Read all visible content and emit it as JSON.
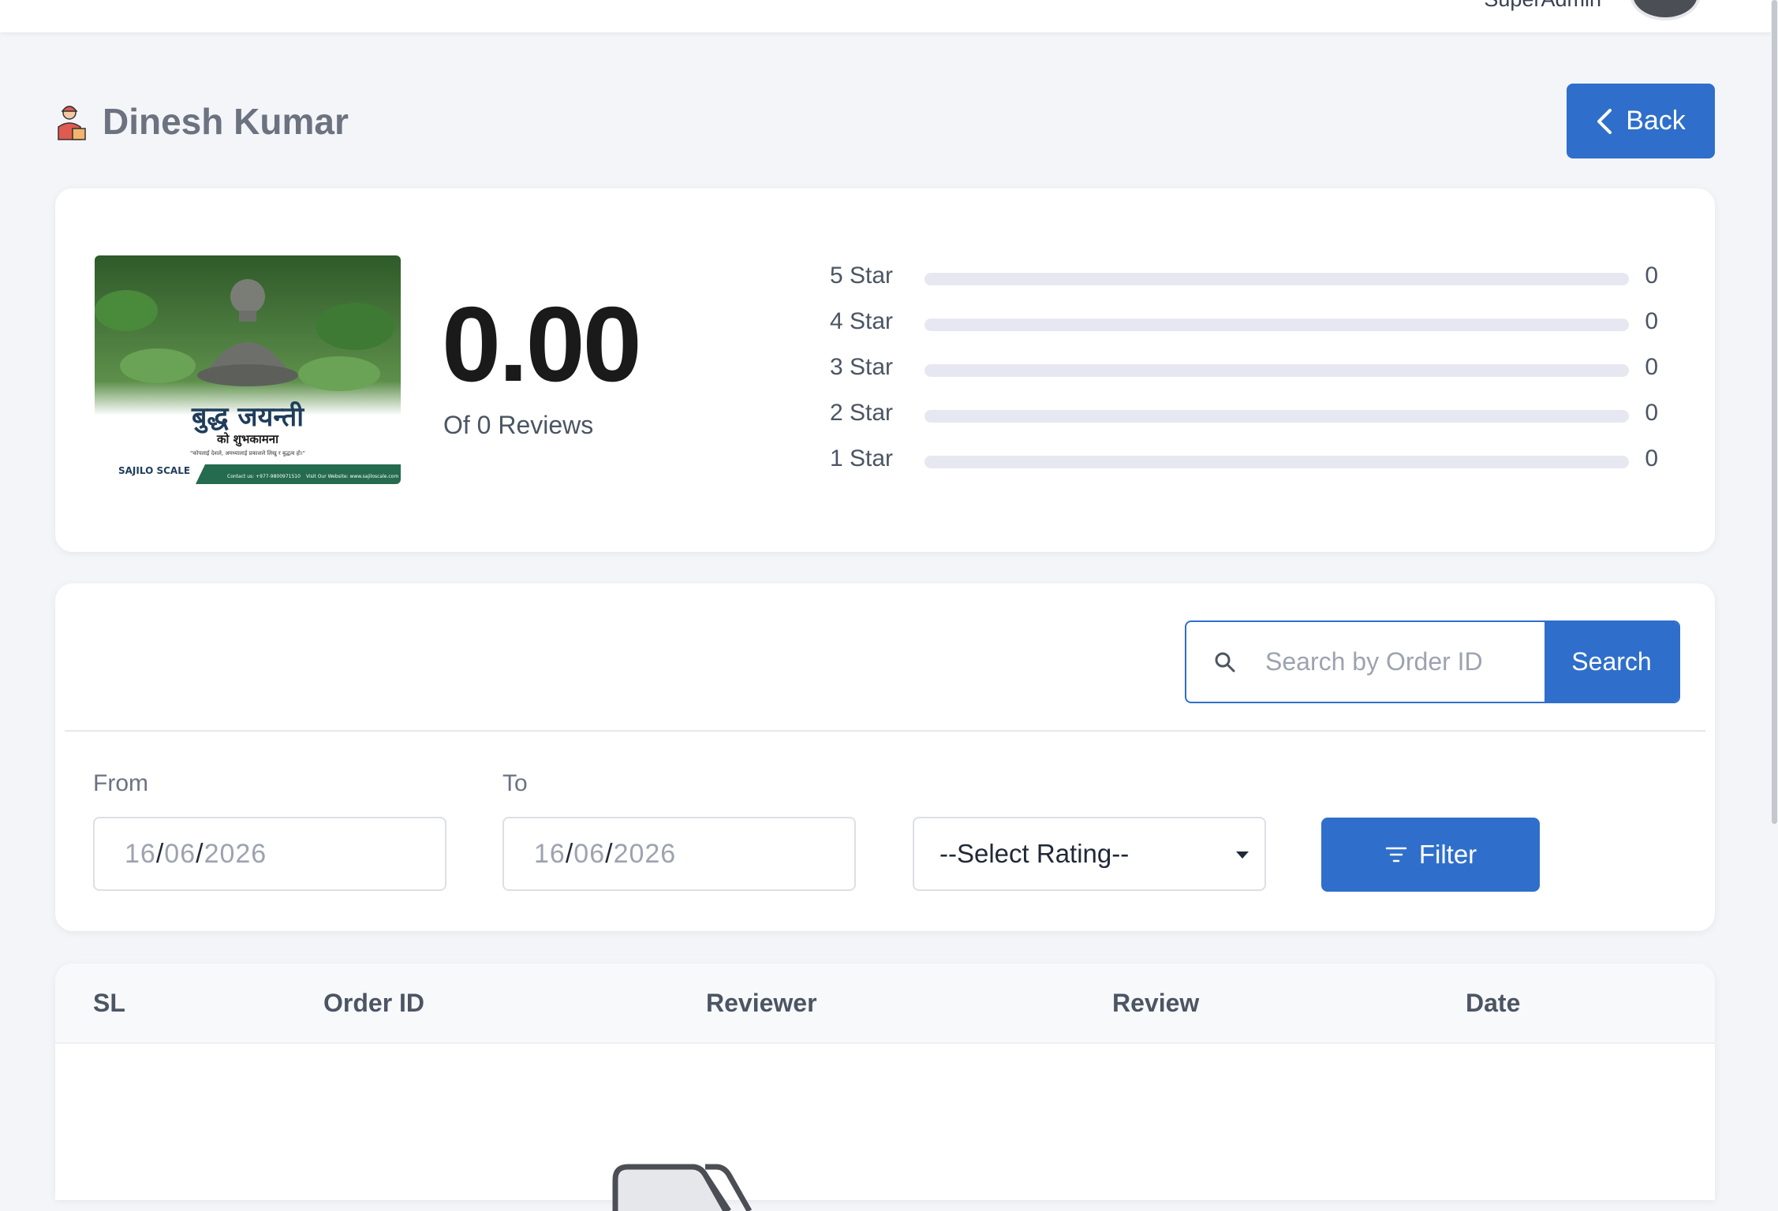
{
  "topbar": {
    "user_name": "SuperAdmin"
  },
  "header": {
    "title": "Dinesh Kumar",
    "back_label": "Back"
  },
  "summary": {
    "average_rating": "0.00",
    "reviews_text": "Of 0 Reviews",
    "product_image": {
      "headline": "बुद्ध जयन्ती",
      "subline": "को शुभकामना",
      "tagline": "\"कोपलाई देशले, अमध्यालाई प्रकाशले लिखु र बुद्धत्व हो।\"",
      "brand": "SAJILO SCALE",
      "contact": "Contact us: +977-9800971510",
      "website": "Visit Our Website: www.sajiloscale.com"
    },
    "rating_rows": [
      {
        "label": "5 Star",
        "count": "0",
        "fraction": 0
      },
      {
        "label": "4 Star",
        "count": "0",
        "fraction": 0
      },
      {
        "label": "3 Star",
        "count": "0",
        "fraction": 0
      },
      {
        "label": "2 Star",
        "count": "0",
        "fraction": 0
      },
      {
        "label": "1 Star",
        "count": "0",
        "fraction": 0
      }
    ]
  },
  "filters": {
    "search_placeholder": "Search by Order ID",
    "search_label": "Search",
    "from_label": "From",
    "to_label": "To",
    "from_date": {
      "day": "16",
      "month": "06",
      "year": "2026"
    },
    "to_date": {
      "day": "16",
      "month": "06",
      "year": "2026"
    },
    "rating_select": "--Select Rating--",
    "filter_label": "Filter"
  },
  "table": {
    "columns": [
      "SL",
      "Order ID",
      "Reviewer",
      "Review",
      "Date"
    ]
  },
  "colors": {
    "primary": "#2f6fcb",
    "background": "#f4f5f8",
    "bar_track": "#e6e7f1"
  },
  "icons": [
    "delivery-person-icon",
    "chevron-left-icon",
    "search-icon",
    "filter-icon",
    "caret-down-icon",
    "empty-box-icon"
  ]
}
